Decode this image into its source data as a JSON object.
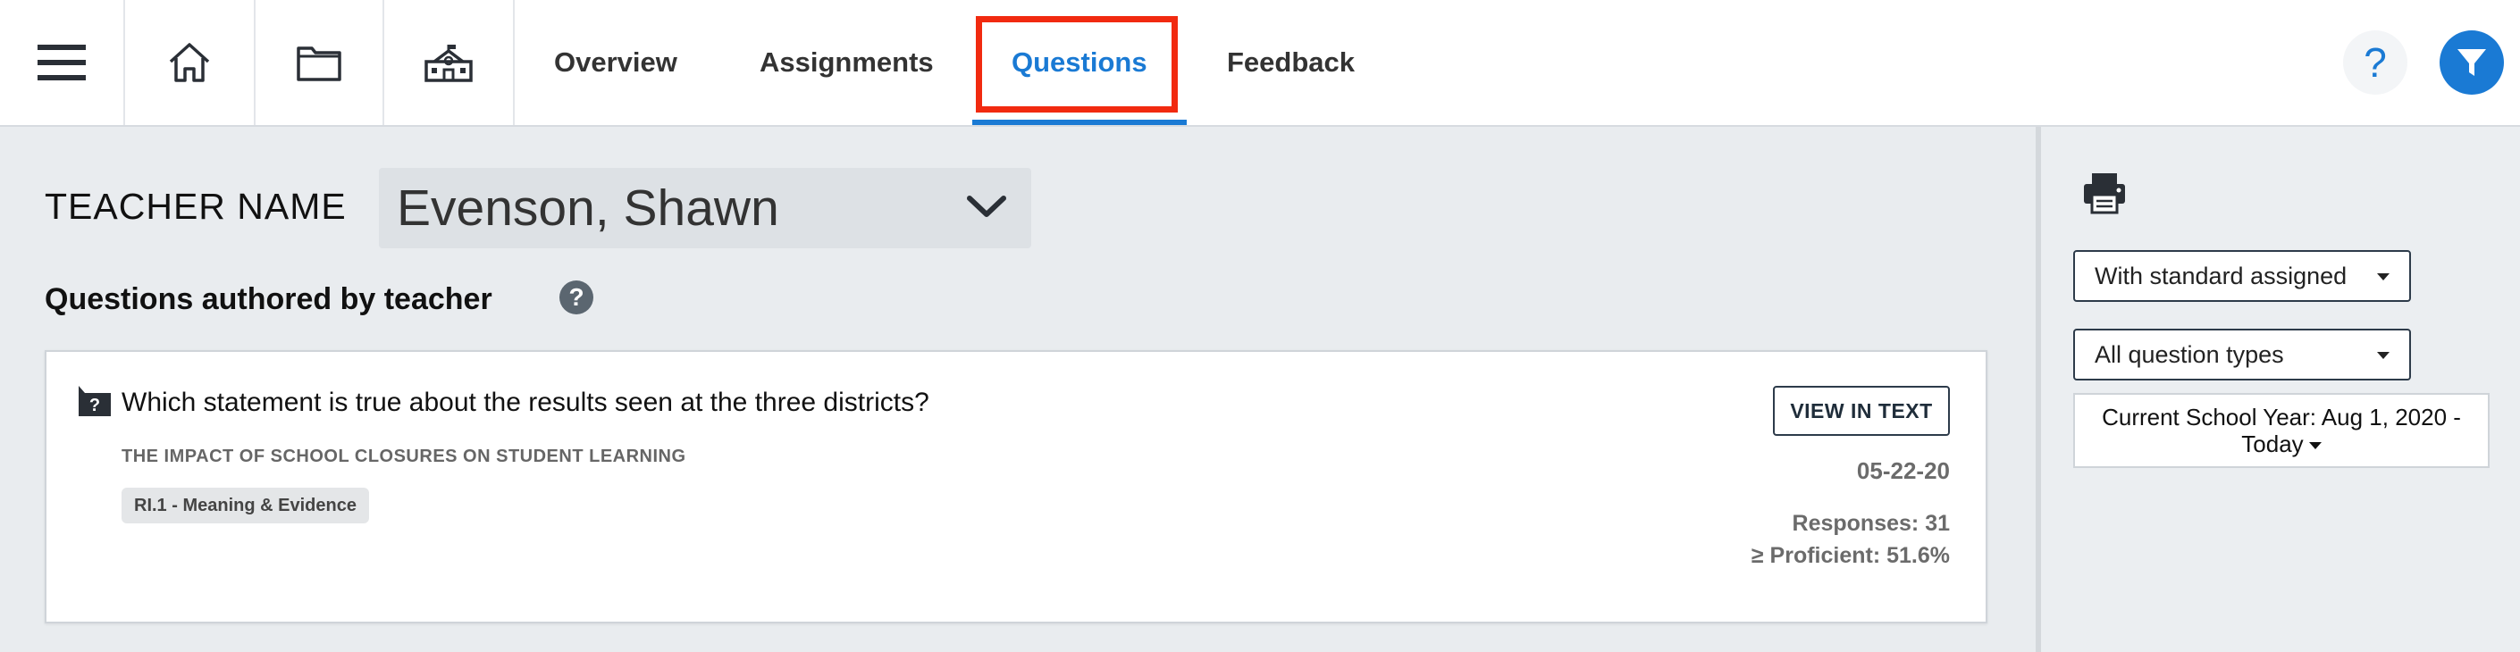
{
  "topnav": {
    "tabs": [
      {
        "label": "Overview"
      },
      {
        "label": "Assignments"
      },
      {
        "label": "Questions"
      },
      {
        "label": "Feedback"
      }
    ],
    "active_tab": "Questions",
    "help_label": "?",
    "icons": [
      "hamburger-menu-icon",
      "home-icon",
      "folder-icon",
      "school-icon",
      "help-icon",
      "filter-icon"
    ],
    "colors": {
      "accent": "#1a7ad4",
      "highlight": "#f12a10"
    }
  },
  "main": {
    "teacher_label": "TEACHER NAME",
    "teacher_name": "Evenson, Shawn",
    "section_title": "Questions authored by teacher",
    "section_help": "?",
    "question": {
      "text": "Which statement is true about the results seen at the three districts?",
      "source": "THE IMPACT OF SCHOOL CLOSURES ON STUDENT LEARNING",
      "standard": "RI.1 - Meaning & Evidence",
      "view_button": "VIEW IN TEXT",
      "date": "05-22-20",
      "responses": "Responses: 31",
      "proficient": "≥ Proficient: 51.6%"
    }
  },
  "sidebar": {
    "standard_filter": "With standard assigned",
    "type_filter": "All question types",
    "year_line1": "Current School Year: Aug 1, 2020 -",
    "year_line2": "Today"
  }
}
